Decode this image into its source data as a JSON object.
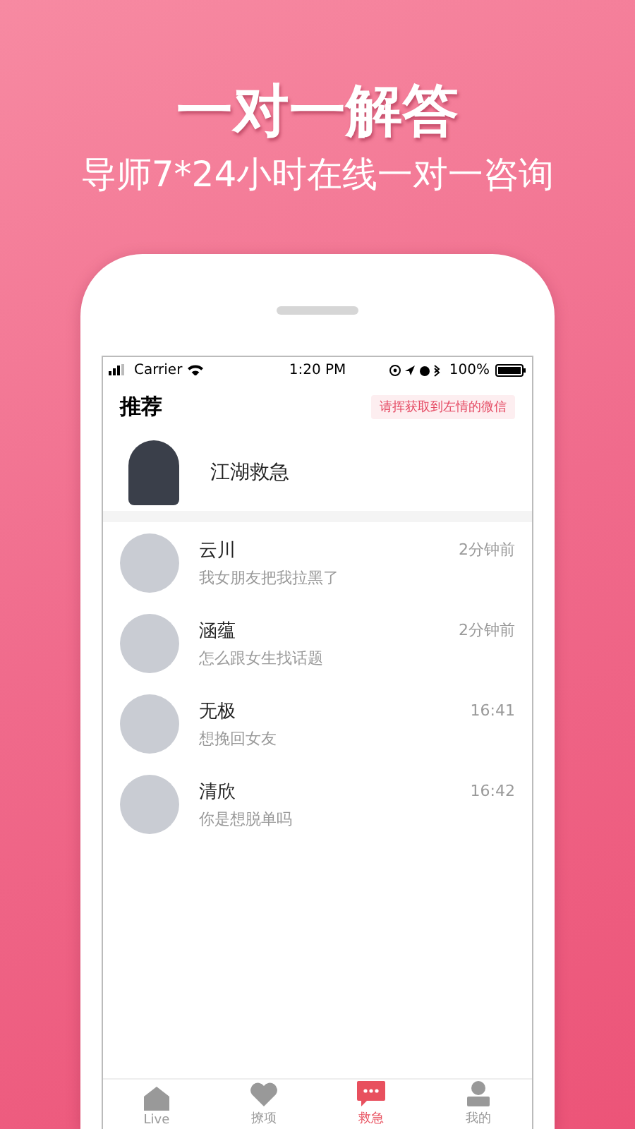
{
  "headline": "一对一解答",
  "subtitle": "导师7*24小时在线一对一咨询",
  "status_bar": {
    "carrier": "Carrier",
    "time": "1:20 PM",
    "battery": "100%"
  },
  "header": {
    "title": "推荐",
    "banner": "请挥获取到左情的微信"
  },
  "featured": {
    "name": "江湖救急"
  },
  "chats": [
    {
      "name": "云川",
      "message": "我女朋友把我拉黑了",
      "time": "2分钟前"
    },
    {
      "name": "涵蕴",
      "message": "怎么跟女生找话题",
      "time": "2分钟前"
    },
    {
      "name": "无极",
      "message": "想挽回女友",
      "time": "16:41"
    },
    {
      "name": "清欣",
      "message": "你是想脱单吗",
      "time": "16:42"
    }
  ],
  "tabs": [
    {
      "kind": "home",
      "label": "Live",
      "selected": false
    },
    {
      "kind": "heart",
      "label": "撩项",
      "selected": false
    },
    {
      "kind": "chat",
      "label": "救急",
      "selected": true
    },
    {
      "kind": "person",
      "label": "我的",
      "selected": false
    }
  ]
}
